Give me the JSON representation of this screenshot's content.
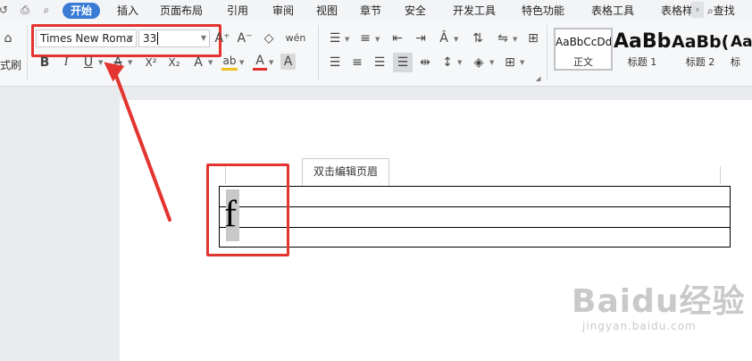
{
  "tabs": {
    "items": [
      "开始",
      "插入",
      "页面布局",
      "引用",
      "审阅",
      "视图",
      "章节",
      "安全",
      "开发工具",
      "特色功能",
      "表格工具",
      "表格样"
    ],
    "active_index": 0,
    "more": "›",
    "search": "查找"
  },
  "toolbar": {
    "format_painter_label": "式刷",
    "font_name": "Times New Roma",
    "font_size": "33",
    "bold": "B",
    "italic": "I",
    "underline": "U",
    "strike": "A",
    "superscript": "X²",
    "subscript": "X₂",
    "text_effect": "A",
    "highlight": "ab",
    "font_color": "A",
    "char_shading": "A",
    "grow_font": "A⁺",
    "shrink_font": "A⁻",
    "phonetic": "wén"
  },
  "styles": [
    {
      "sample": "AaBbCcDd",
      "name": "正文"
    },
    {
      "sample": "AaBb",
      "name": "标题 1"
    },
    {
      "sample": "AaBb(",
      "name": "标题 2"
    },
    {
      "sample": "Aa",
      "name": "标"
    }
  ],
  "document": {
    "header_tip": "双击编辑页眉",
    "typed_letter": "f"
  },
  "watermark": {
    "logo": "Baidu经验",
    "url": "jingyan.baidu.com"
  },
  "colors": {
    "active_tab": "#3a7bd5",
    "annotation_red": "#e3342f",
    "highlight_bar": "#f0c020",
    "font_color_bar": "#e03030"
  }
}
